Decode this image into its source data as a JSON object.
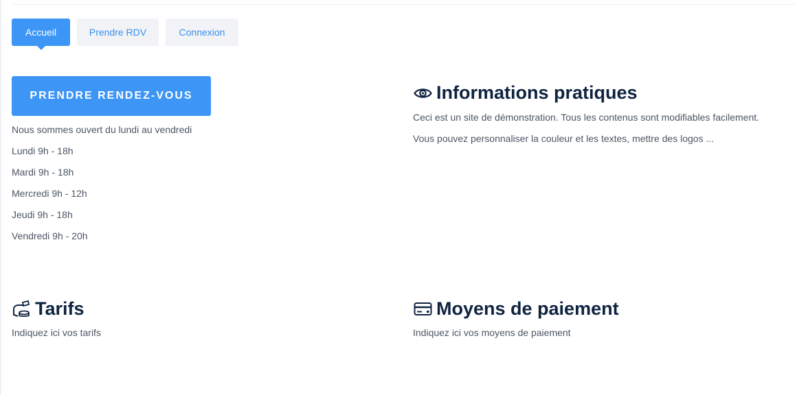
{
  "tabs": [
    {
      "label": "Accueil",
      "active": true
    },
    {
      "label": "Prendre RDV",
      "active": false
    },
    {
      "label": "Connexion",
      "active": false
    }
  ],
  "cta_label": "PRENDRE RENDEZ-VOUS",
  "hours": {
    "intro": "Nous sommes ouvert du lundi au vendredi",
    "days": [
      "Lundi 9h - 18h",
      "Mardi 9h - 18h",
      "Mercredi 9h - 12h",
      "Jeudi 9h - 18h",
      "Vendredi 9h - 20h"
    ]
  },
  "info": {
    "icon": "eye-icon",
    "title": "Informations pratiques",
    "lines": [
      "Ceci est un site de démonstration. Tous les contenus sont modifiables facilement.",
      "Vous pouvez personnaliser la couleur et les textes, mettre des logos ..."
    ]
  },
  "tarifs": {
    "icon": "money-hand-icon",
    "title": "Tarifs",
    "text": "Indiquez ici vos tarifs"
  },
  "paiement": {
    "icon": "credit-card-icon",
    "title": "Moyens de paiement",
    "text": "Indiquez ici vos moyens de paiement"
  },
  "colors": {
    "accent": "#3d95f6",
    "heading": "#0f2340",
    "tab_bg": "#f1f3f6",
    "text": "#4b5563"
  }
}
